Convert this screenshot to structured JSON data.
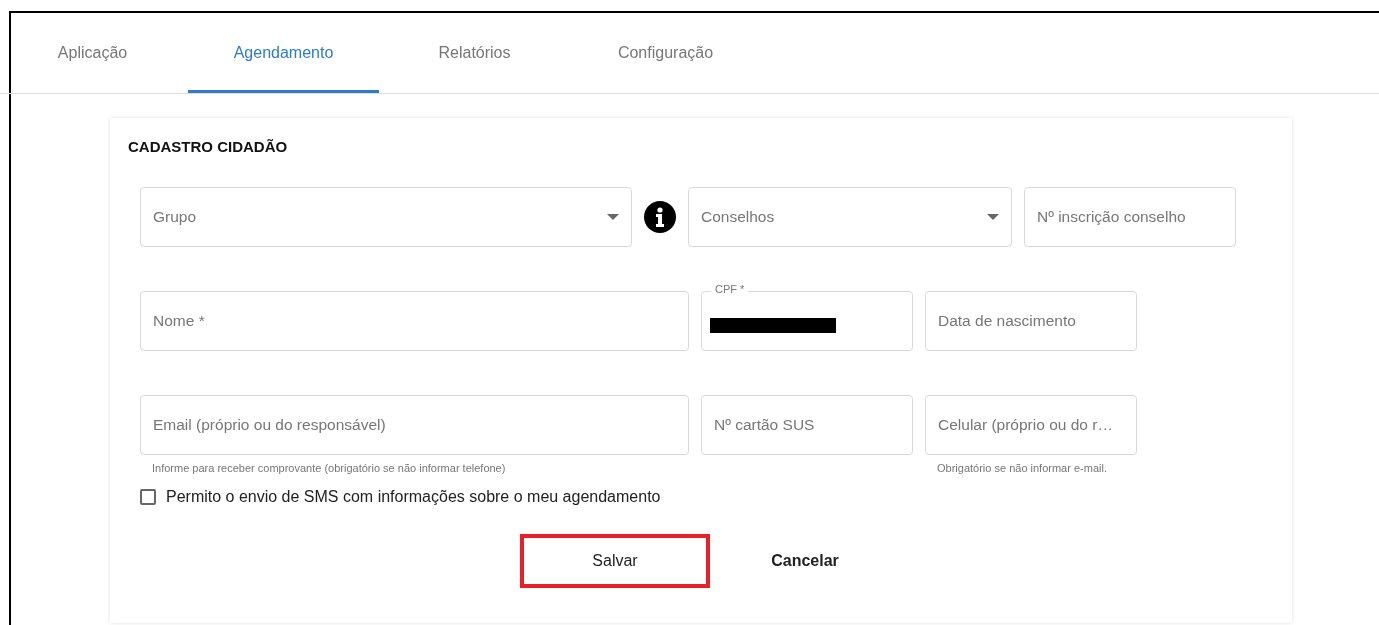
{
  "tabs": [
    {
      "label": "Aplicação",
      "selected": false
    },
    {
      "label": "Agendamento",
      "selected": true
    },
    {
      "label": "Relatórios",
      "selected": false
    },
    {
      "label": "Configuração",
      "selected": false
    }
  ],
  "form": {
    "title": "CADASTRO CIDADÃO",
    "rows": [
      {
        "fields": [
          {
            "kind": "select",
            "placeholder": "Grupo",
            "info": true
          },
          {
            "kind": "select",
            "placeholder": "Conselhos"
          },
          {
            "kind": "text",
            "placeholder": "Nº inscrição conselho"
          }
        ]
      },
      {
        "fields": [
          {
            "kind": "text",
            "placeholder": "Nome *"
          },
          {
            "kind": "redacted",
            "label": "CPF *"
          },
          {
            "kind": "text",
            "placeholder": "Data de nascimento"
          }
        ]
      },
      {
        "fields": [
          {
            "kind": "text",
            "placeholder": "Email (próprio ou do responsável)",
            "helper": "Informe para receber comprovante (obrigatório se não informar telefone)"
          },
          {
            "kind": "text",
            "placeholder": "Nº cartão SUS"
          },
          {
            "kind": "text",
            "placeholder": "Celular (próprio ou do r…",
            "helper": "Obrigatório se não informar e-mail."
          }
        ]
      }
    ],
    "sms_consent": {
      "label": "Permito o envio de SMS com informações sobre o meu agendamento",
      "checked": false
    },
    "buttons": [
      {
        "label": "Salvar",
        "highlighted": true
      },
      {
        "label": "Cancelar",
        "highlighted": false
      }
    ]
  }
}
